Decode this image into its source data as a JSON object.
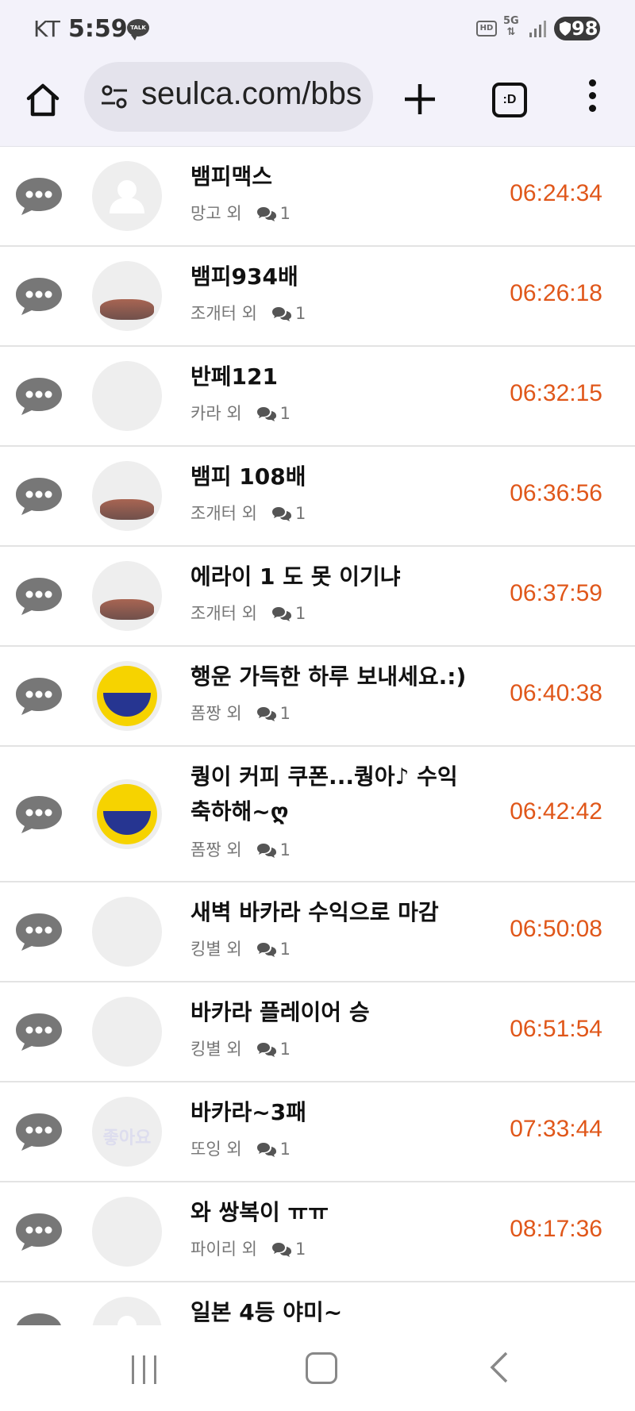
{
  "status_bar": {
    "carrier": "KT",
    "time": "5:59",
    "talk_badge": "TALK",
    "hd_badge": "HD",
    "network": "5G",
    "battery": "98"
  },
  "browser": {
    "url": "seulca.com/bbs",
    "tabs_label": ":D"
  },
  "comment_count_icon": "comment-bubbles-icon",
  "accent_time_color": "#e0571a",
  "items": [
    {
      "title": "뱀피맥스",
      "meta": "망고 외",
      "count": "1",
      "time": "06:24:34",
      "avatar": "default"
    },
    {
      "title": "뱀피934배",
      "meta": "조개터 외",
      "count": "1",
      "time": "06:26:18",
      "avatar": "crab"
    },
    {
      "title": "반페121",
      "meta": "카라 외",
      "count": "1",
      "time": "06:32:15",
      "avatar": "tiger"
    },
    {
      "title": "뱀피 108배",
      "meta": "조개터 외",
      "count": "1",
      "time": "06:36:56",
      "avatar": "crab"
    },
    {
      "title": "에라이 1 도 못 이기냐",
      "meta": "조개터 외",
      "count": "1",
      "time": "06:37:59",
      "avatar": "crab"
    },
    {
      "title": "행운 가득한 하루 보내세요.:)",
      "meta": "폼짱 외",
      "count": "1",
      "time": "06:40:38",
      "avatar": "smile"
    },
    {
      "title": "퀑이 커피 쿠폰...퀑아♪ 수익 축하해~ღ",
      "meta": "폼짱 외",
      "count": "1",
      "time": "06:42:42",
      "avatar": "smile"
    },
    {
      "title": "새벽 바카라 수익으로 마감",
      "meta": "킹별 외",
      "count": "1",
      "time": "06:50:08",
      "avatar": "sea"
    },
    {
      "title": "바카라 플레이어 승",
      "meta": "킹별 외",
      "count": "1",
      "time": "06:51:54",
      "avatar": "sea"
    },
    {
      "title": "바카라~3패",
      "meta": "또잉 외",
      "count": "1",
      "time": "07:33:44",
      "avatar": "dark",
      "avatar_text": "좋아요"
    },
    {
      "title": "와 쌍복이 ㅠㅠ",
      "meta": "파이리 외",
      "count": "1",
      "time": "08:17:36",
      "avatar": "coin"
    },
    {
      "title": "일본 4등 야미~",
      "meta": "",
      "count": "",
      "time": "",
      "avatar": "default"
    }
  ]
}
